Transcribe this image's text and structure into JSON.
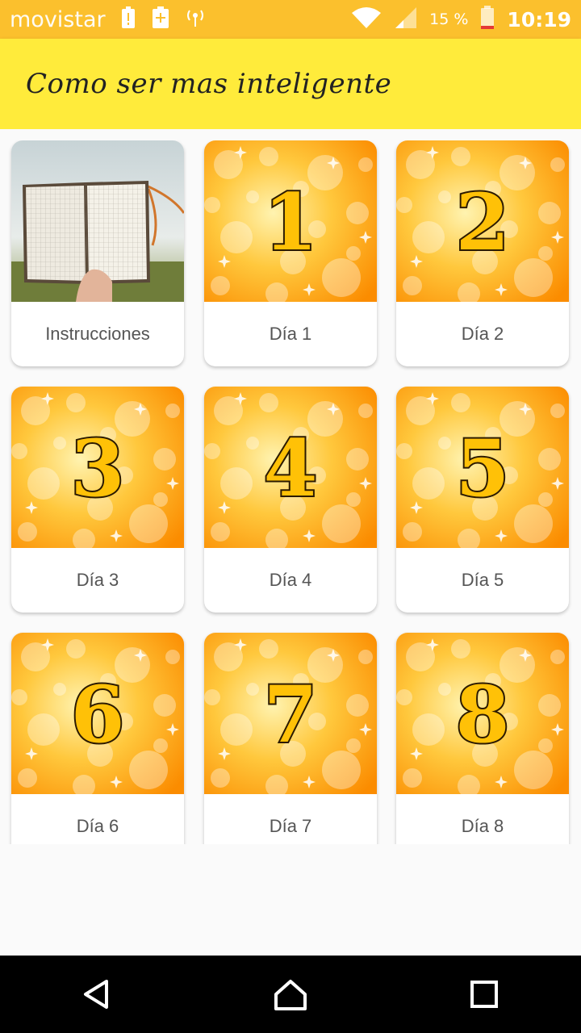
{
  "status_bar": {
    "carrier": "movistar",
    "battery_percent": "15 %",
    "time": "10:19",
    "icons": [
      "alert-battery-icon",
      "battery-plus-icon",
      "radio-signal-icon",
      "wifi-icon",
      "cell-signal-icon",
      "battery-icon"
    ]
  },
  "app_bar": {
    "title": "Como ser mas inteligente"
  },
  "items": [
    {
      "label": "Instrucciones",
      "image": "notebook-photo",
      "number": ""
    },
    {
      "label": "Día 1",
      "image": "golden-bokeh",
      "number": "1"
    },
    {
      "label": "Día 2",
      "image": "golden-bokeh",
      "number": "2"
    },
    {
      "label": "Día 3",
      "image": "golden-bokeh",
      "number": "3"
    },
    {
      "label": "Día 4",
      "image": "golden-bokeh",
      "number": "4"
    },
    {
      "label": "Día 5",
      "image": "golden-bokeh",
      "number": "5"
    },
    {
      "label": "Día 6",
      "image": "golden-bokeh",
      "number": "6"
    },
    {
      "label": "Día 7",
      "image": "golden-bokeh",
      "number": "7"
    },
    {
      "label": "Día 8",
      "image": "golden-bokeh",
      "number": "8"
    }
  ],
  "nav_bar": {
    "icons": [
      "back-icon",
      "home-icon",
      "recents-icon"
    ]
  },
  "colors": {
    "status_bar": "#fbc02d",
    "app_bar": "#ffeb3b",
    "card_gold": "#ffb300"
  }
}
